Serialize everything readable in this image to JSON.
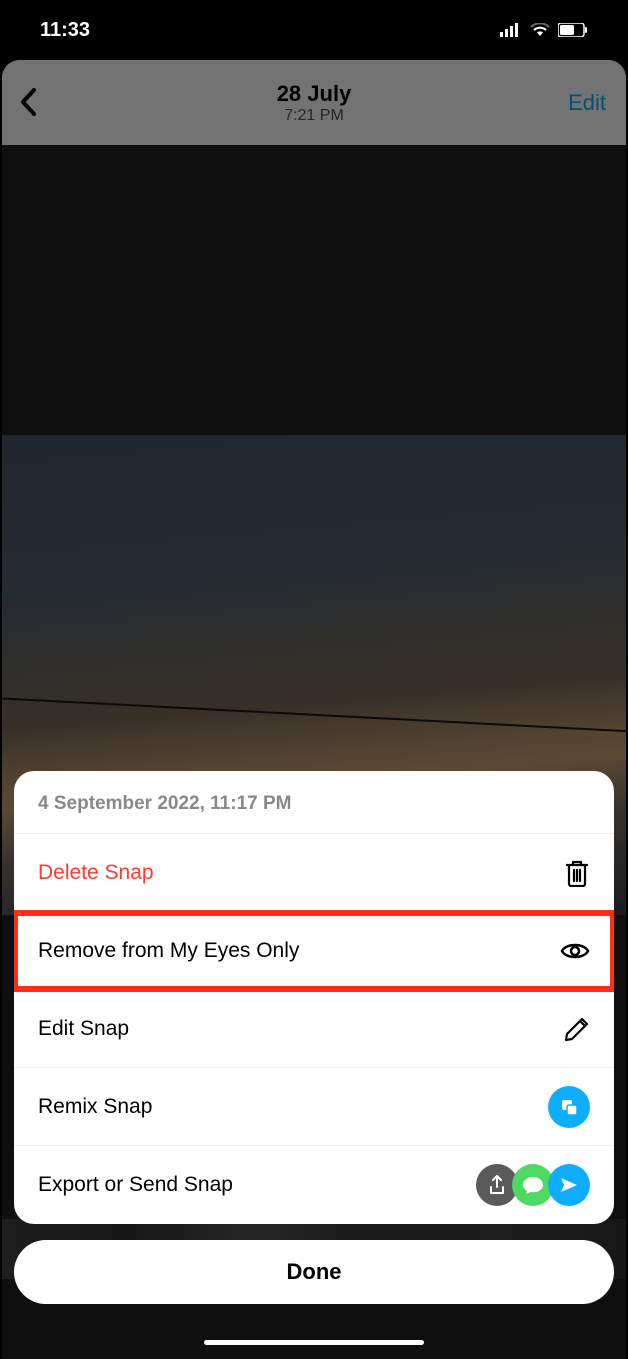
{
  "status_bar": {
    "time": "11:33"
  },
  "header": {
    "date": "28 July",
    "time": "7:21 PM",
    "edit": "Edit"
  },
  "sheet": {
    "timestamp": "4 September 2022, 11:17 PM",
    "items": [
      {
        "label": "Delete Snap",
        "icon": "trash",
        "destructive": true
      },
      {
        "label": "Remove from My Eyes Only",
        "icon": "eye",
        "highlighted": true
      },
      {
        "label": "Edit Snap",
        "icon": "pencil"
      },
      {
        "label": "Remix Snap",
        "icon": "remix"
      },
      {
        "label": "Export or Send Snap",
        "icon": "export-send"
      }
    ],
    "done": "Done"
  }
}
